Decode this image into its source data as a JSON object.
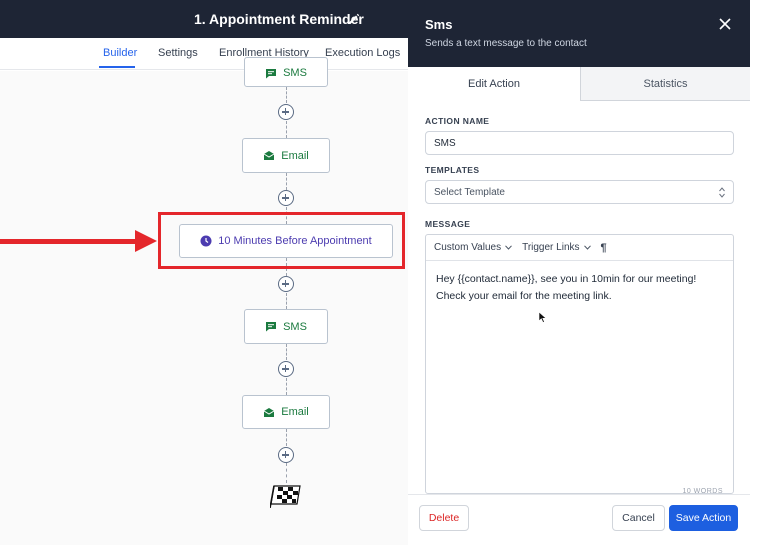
{
  "workflow": {
    "title": "1. Appointment Reminder",
    "tabs": [
      {
        "label": "Builder",
        "active": true
      },
      {
        "label": "Settings",
        "active": false
      },
      {
        "label": "Enrollment History",
        "active": false
      },
      {
        "label": "Execution Logs",
        "active": false
      }
    ]
  },
  "canvas": {
    "nodes": [
      {
        "label": "SMS",
        "icon": "message-icon"
      },
      {
        "label": "Email",
        "icon": "envelope-icon"
      },
      {
        "label": "10 Minutes Before Appointment",
        "icon": "clock-icon"
      },
      {
        "label": "SMS",
        "icon": "message-icon"
      },
      {
        "label": "Email",
        "icon": "envelope-icon"
      }
    ],
    "end_icon": "finish-flag-icon"
  },
  "panel": {
    "title": "Sms",
    "subtitle": "Sends a text message to the contact",
    "tabs": [
      {
        "label": "Edit Action",
        "active": true
      },
      {
        "label": "Statistics",
        "active": false
      }
    ],
    "action_name_label": "ACTION NAME",
    "action_name_value": "SMS",
    "templates_label": "TEMPLATES",
    "templates_placeholder": "Select Template",
    "message_label": "MESSAGE",
    "toolbar": {
      "custom_values": "Custom Values",
      "trigger_links": "Trigger Links",
      "paragraph": "¶"
    },
    "message_line1": "Hey {{contact.name}}, see you in 10min for our meeting!",
    "message_line2": "Check your email for the meeting link.",
    "word_count": "10 WORDS",
    "buttons": {
      "delete": "Delete",
      "cancel": "Cancel",
      "save": "Save Action"
    }
  },
  "colors": {
    "header_bg": "#1e2535",
    "accent": "#1d5fe0",
    "highlight": "#e4262b",
    "node_green": "#1b7a3f",
    "wait_purple": "#4c3cb0"
  }
}
